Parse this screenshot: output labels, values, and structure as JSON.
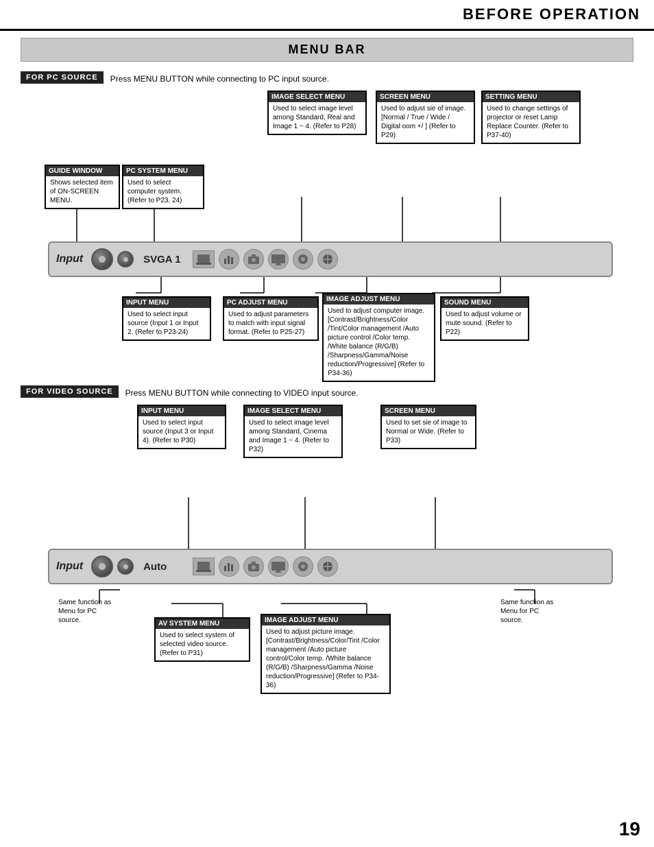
{
  "header": {
    "title": "BEFORE OPERATION",
    "page_number": "19"
  },
  "section": {
    "title": "MENU BAR"
  },
  "pc_source": {
    "label": "FOR PC SOURCE",
    "description": "Press MENU BUTTON while connecting to PC input source.",
    "projector_input": "Input",
    "projector_source": "SVGA 1",
    "callouts": {
      "guide_window": {
        "title": "GUIDE WINDOW",
        "text": "Shows selected item of ON-SCREEN MENU."
      },
      "pc_system_menu": {
        "title": "PC SYSTEM MENU",
        "text": "Used to select computer system. (Refer to P23, 24)"
      },
      "image_select_menu": {
        "title": "IMAGE SELECT MENU",
        "text": "Used to select image level among Standard, Real and Image 1 ~ 4. (Refer to P28)"
      },
      "screen_menu": {
        "title": "SCREEN MENU",
        "text": "Used to adjust si​e of image. [Normal / True / Wide / Digital  oom +/  ] (Refer to P29)"
      },
      "setting_menu": {
        "title": "SETTING MENU",
        "text": "Used to change settings of projector or reset Lamp Replace Counter. (Refer to P37-40)"
      },
      "input_menu": {
        "title": "INPUT MENU",
        "text": "Used to select input source (Input 1 or  Input 2. (Refer to P23-24)"
      },
      "pc_adjust_menu": {
        "title": "PC ADJUST MENU",
        "text": "Used to adjust parameters to match with input signal format. (Refer to P25-27)"
      },
      "image_adjust_menu": {
        "title": "IMAGE ADJUST MENU",
        "text": "Used to adjust computer image. [Contrast/Brightness/Color /Tint/Color management /Auto picture control /Color temp. /White balance (R/G/B) /Sharpness/Gamma/Noise reduction/Progressive] (Refer to P34-36)"
      },
      "sound_menu": {
        "title": "SOUND MENU",
        "text": "Used to adjust volume or mute sound. (Refer to P22)"
      }
    }
  },
  "video_source": {
    "label": "FOR VIDEO SOURCE",
    "description": "Press MENU BUTTON while connecting to VIDEO input source.",
    "projector_input": "Input",
    "projector_source": "Auto",
    "same_function_left": "Same function as Menu for PC source.",
    "same_function_right": "Same function as Menu for PC source.",
    "callouts": {
      "input_menu": {
        "title": "INPUT MENU",
        "text": "Used to select input source (Input 3 or Input 4). (Refer to P30)"
      },
      "image_select_menu": {
        "title": "IMAGE SELECT MENU",
        "text": "Used to select image level among Standard, Cinema and Image 1 ~ 4. (Refer to P32)"
      },
      "screen_menu": {
        "title": "SCREEN MENU",
        "text": "Used to set si​e of image to Normal or Wide. (Refer to P33)"
      },
      "av_system_menu": {
        "title": "AV SYSTEM MENU",
        "text": "Used to select system of selected video source. (Refer to P31)"
      },
      "image_adjust_menu": {
        "title": "IMAGE ADJUST MENU",
        "text": "Used to adjust picture image. [Contrast/Brightness/Color/Tint /Color management /Auto picture control/Color temp. /White balance (R/G/B) /Sharpness/Gamma /Noise reduction/Progressive] (Refer to P34-36)"
      }
    }
  }
}
